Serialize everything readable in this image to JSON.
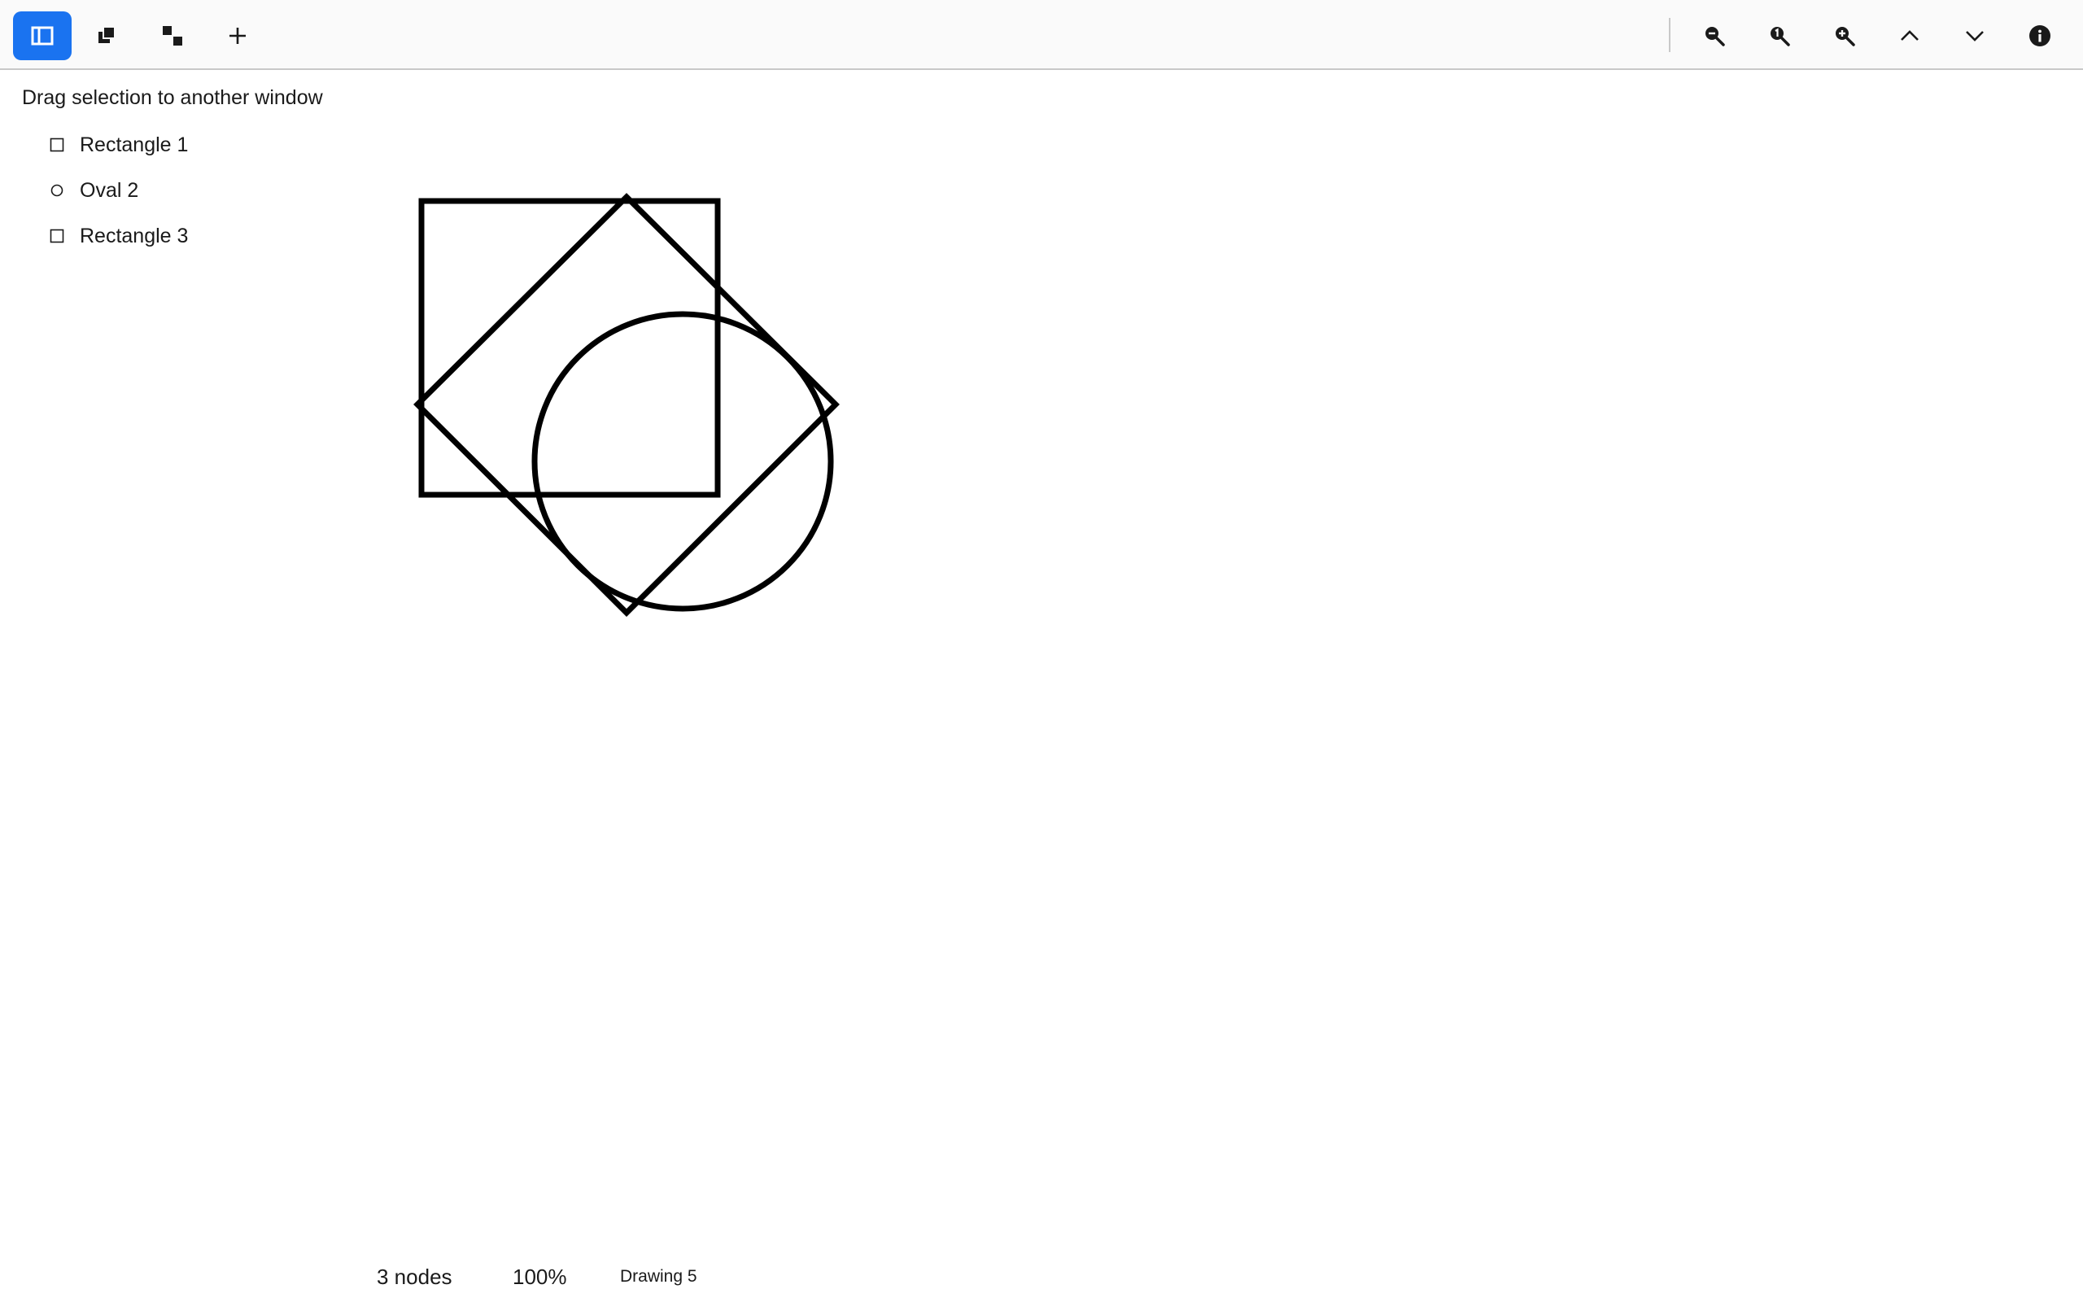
{
  "toolbar": {
    "left_buttons": [
      {
        "icon": "sidebar-toggle-icon",
        "active": true
      },
      {
        "icon": "bring-to-front-icon",
        "active": false
      },
      {
        "icon": "distribute-icon",
        "active": false
      },
      {
        "icon": "plus-icon",
        "active": false
      }
    ],
    "right_buttons": [
      {
        "icon": "zoom-out-icon"
      },
      {
        "icon": "zoom-actual-size-icon"
      },
      {
        "icon": "zoom-in-icon"
      },
      {
        "icon": "chevron-up-icon"
      },
      {
        "icon": "chevron-down-icon"
      },
      {
        "icon": "info-icon"
      }
    ],
    "accent_color": "#1a73f0"
  },
  "sidebar": {
    "hint": "Drag selection to another window",
    "items": [
      {
        "label": "Rectangle 1",
        "icon": "square-outline-icon"
      },
      {
        "label": "Oval 2",
        "icon": "circle-outline-icon"
      },
      {
        "label": "Rectangle 3",
        "icon": "square-outline-icon"
      }
    ]
  },
  "canvas": {
    "shapes": [
      {
        "name": "Rectangle 1",
        "type": "rectangle"
      },
      {
        "name": "Oval 2",
        "type": "oval"
      },
      {
        "name": "Rectangle 3",
        "type": "rectangle",
        "rotation": 45
      }
    ]
  },
  "status": {
    "node_count": "3 nodes",
    "zoom": "100%",
    "document": "Drawing 5"
  }
}
